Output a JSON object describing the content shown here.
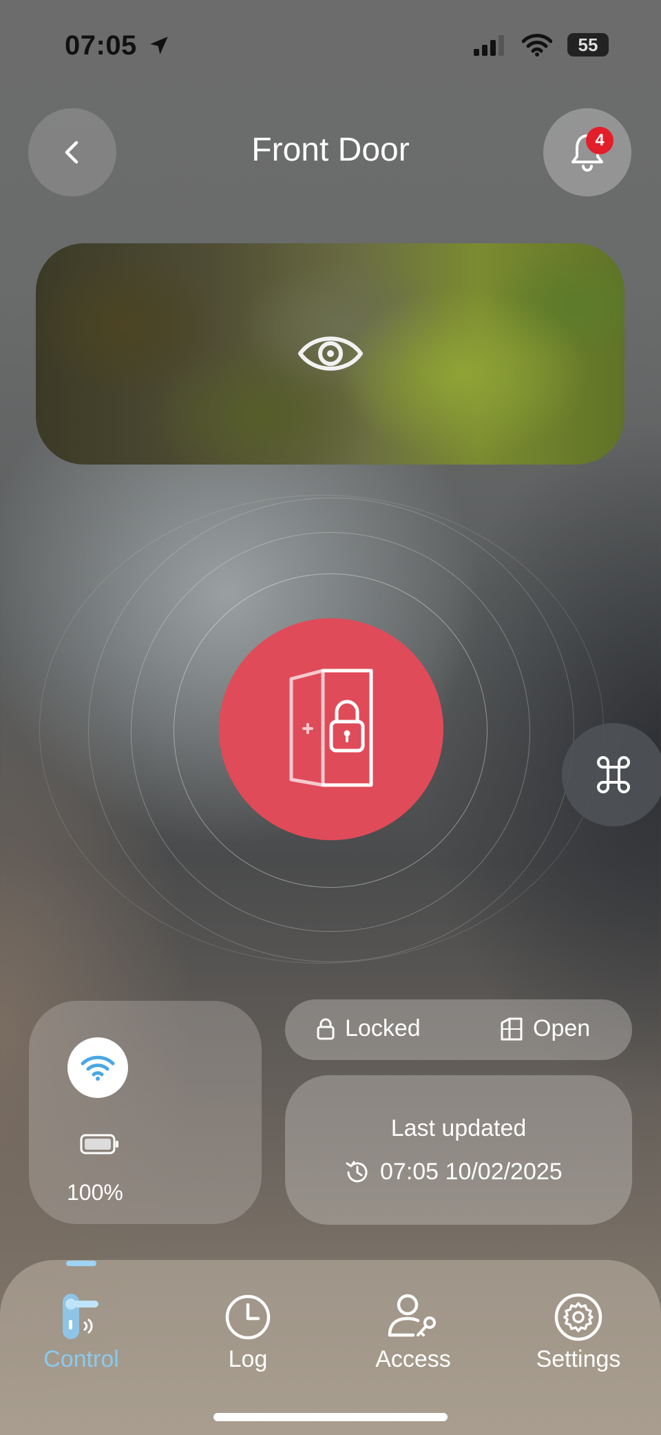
{
  "status_bar": {
    "time": "07:05",
    "battery": "55",
    "icons": [
      "location-arrow-icon",
      "signal-icon",
      "wifi-icon",
      "battery-icon"
    ]
  },
  "header": {
    "title": "Front Door",
    "notification_count": "4",
    "icons": [
      "chevron-left-icon",
      "bell-icon"
    ]
  },
  "camera": {
    "icon": "eye-icon"
  },
  "lock": {
    "icon": "door-lock-icon",
    "shortcut_icon": "command-icon",
    "color": "#e04b59"
  },
  "device": {
    "connection_icon": "wifi-icon",
    "battery_icon": "battery-icon",
    "battery_level": "100%"
  },
  "state": {
    "lock_label": "Locked",
    "door_label": "Open"
  },
  "update": {
    "label": "Last updated",
    "timestamp": "07:05 10/02/2025"
  },
  "tabs": [
    {
      "label": "Control",
      "icon": "door-handle-icon",
      "active": true
    },
    {
      "label": "Log",
      "icon": "clock-icon",
      "active": false
    },
    {
      "label": "Access",
      "icon": "user-key-icon",
      "active": false
    },
    {
      "label": "Settings",
      "icon": "gear-icon",
      "active": false
    }
  ],
  "colors": {
    "accent": "#8cc9ee",
    "lock_red": "#e04b59",
    "badge_red": "#e31e2a"
  }
}
